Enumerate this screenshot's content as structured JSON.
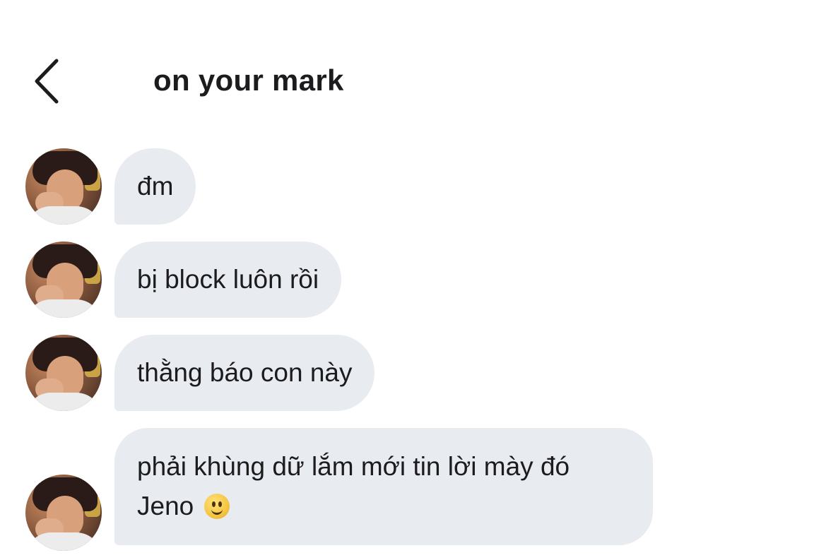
{
  "header": {
    "back_icon": "chevron-left-icon",
    "title": "on your mark"
  },
  "messages": [
    {
      "text": "đm"
    },
    {
      "text": "bị block luôn rồi"
    },
    {
      "text": "thằng báo con này"
    },
    {
      "line1": "phải khùng dữ lắm mới tin lời mày đó",
      "line2": "Jeno",
      "emoji": "slightly-smiling-face"
    }
  ],
  "colors": {
    "bubble_bg": "#e8ebf0",
    "text": "#1c1c1e",
    "background": "#ffffff"
  }
}
